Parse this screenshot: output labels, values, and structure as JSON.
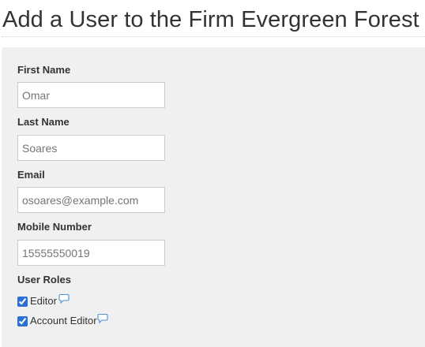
{
  "page": {
    "title": "Add a User to the Firm Evergreen Forest"
  },
  "form": {
    "first_name": {
      "label": "First Name",
      "placeholder": "Omar"
    },
    "last_name": {
      "label": "Last Name",
      "placeholder": "Soares"
    },
    "email": {
      "label": "Email",
      "placeholder": "osoares@example.com"
    },
    "mobile": {
      "label": "Mobile Number",
      "placeholder": "15555550019"
    },
    "user_roles": {
      "label": "User Roles",
      "roles": [
        {
          "label": "Editor",
          "checked": true,
          "icon": "comment-bubble-icon"
        },
        {
          "label": "Account Editor",
          "checked": true,
          "icon": "comment-bubble-icon"
        }
      ]
    }
  },
  "colors": {
    "panel_background": "#f0f0f0",
    "text": "#333333",
    "input_border": "#cccccc",
    "info_icon": "#4a8fd8",
    "checkbox_accent": "#2f6fd0"
  }
}
